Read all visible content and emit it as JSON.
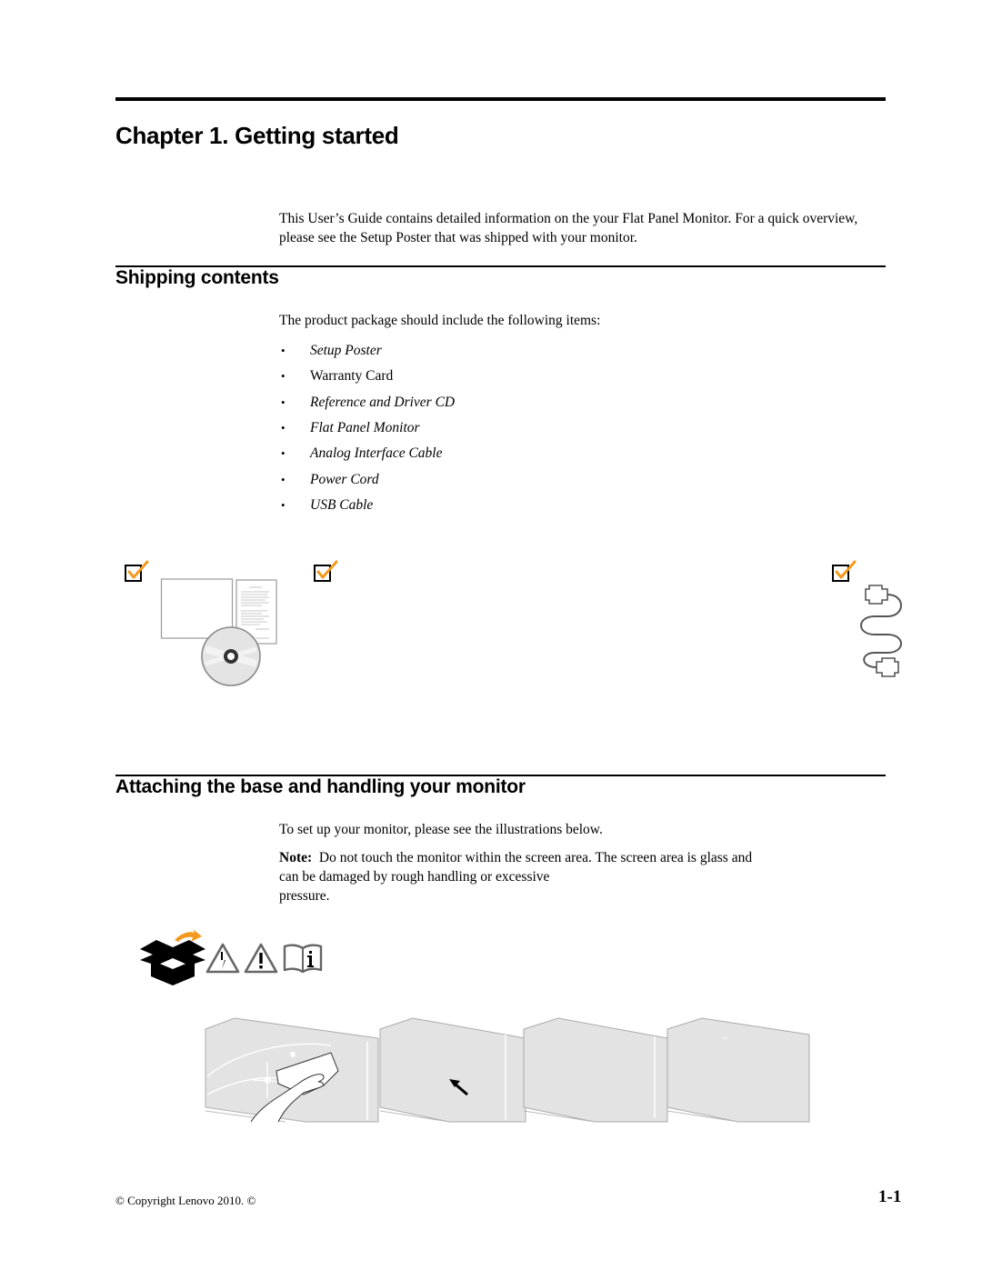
{
  "document": {
    "chapter_title": "Chapter 1. Getting started",
    "intro": "This User’s Guide contains detailed information on the your Flat Panel Monitor.  For a quick overview, please see the Setup Poster that was shipped with your monitor."
  },
  "shipping": {
    "title": "Shipping contents",
    "lead": "The product package should include the following items:",
    "bullet_glyph": "•",
    "items": [
      {
        "label": "Setup Poster",
        "italic": true
      },
      {
        "label": "Warranty Card",
        "italic": false
      },
      {
        "label": "Reference and Driver CD",
        "italic": true
      },
      {
        "label": "Flat Panel Monitor",
        "italic": true
      },
      {
        "label": "Analog Interface Cable",
        "italic": true
      },
      {
        "label": "Power Cord",
        "italic": true
      },
      {
        "label": "USB Cable",
        "italic": true
      }
    ],
    "illustrations": [
      {
        "name": "documents-and-cd",
        "icon": "checkbox-checked-icon"
      },
      {
        "name": "monitor-placeholder",
        "icon": "checkbox-checked-icon"
      },
      {
        "name": "cable",
        "icon": "checkbox-checked-icon"
      }
    ],
    "accent_color": "#f39a1e"
  },
  "attaching": {
    "title": "Attaching the base and handling your monitor",
    "lead": "To set up your monitor, please see the illustrations below.",
    "note_label": "Note:",
    "note_line1": "  Do not touch the monitor within the screen area. The screen area is glass and",
    "note_line2": "can be damaged by rough handling or excessive",
    "note_line3": "pressure.",
    "icons": [
      "open-box-icon",
      "electric-hazard-icon",
      "warning-icon",
      "info-manual-icon"
    ],
    "panels": [
      "cleaning-screen-panel",
      "arrow-panel",
      "blank-panel-1",
      "blank-panel-2"
    ]
  },
  "footer": {
    "copyright": "© Copyright Lenovo 2010. ©",
    "page_number": "1-1"
  }
}
